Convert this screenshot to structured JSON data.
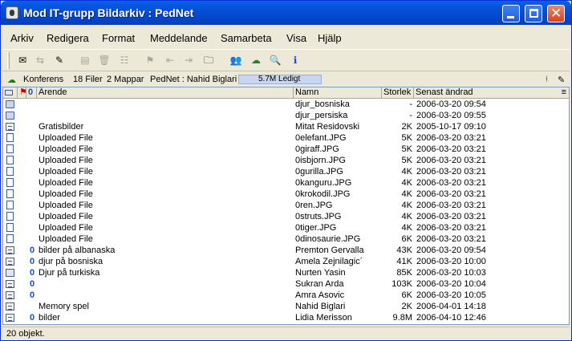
{
  "window": {
    "title": "Mod IT-grupp Bildarkiv : PedNet"
  },
  "menu": [
    "Arkiv",
    "Redigera",
    "Format",
    "Meddelande",
    "Samarbeta",
    "Visa",
    "Hjälp"
  ],
  "infobar": {
    "conference": "Konferens",
    "files": "18 Filer",
    "folders": "2 Mappar",
    "user": "PedNet : Nahid Biglari",
    "free": "5.7M Ledigt"
  },
  "columns": {
    "subject": "Ärende",
    "name": "Namn",
    "size": "Storlek",
    "date": "Senast ändrad"
  },
  "rows": [
    {
      "icon": "folder",
      "clip": "",
      "subject": "",
      "name": "djur_bosniska",
      "size": "-",
      "date": "2006-03-20  09:54"
    },
    {
      "icon": "folder",
      "clip": "",
      "subject": "",
      "name": "djur_persiska",
      "size": "-",
      "date": "2006-03-20  09:55"
    },
    {
      "icon": "msg",
      "clip": "",
      "subject": "Gratisbilder",
      "name": "Mitat Residovski",
      "size": "2K",
      "date": "2005-10-17  09:10"
    },
    {
      "icon": "file",
      "clip": "",
      "subject": "Uploaded File",
      "name": "0elefant.JPG",
      "size": "5K",
      "date": "2006-03-20  03:21"
    },
    {
      "icon": "file",
      "clip": "",
      "subject": "Uploaded File",
      "name": "0giraff.JPG",
      "size": "5K",
      "date": "2006-03-20  03:21"
    },
    {
      "icon": "file",
      "clip": "",
      "subject": "Uploaded File",
      "name": "0isbjorn.JPG",
      "size": "5K",
      "date": "2006-03-20  03:21"
    },
    {
      "icon": "file",
      "clip": "",
      "subject": "Uploaded File",
      "name": "0gurilla.JPG",
      "size": "4K",
      "date": "2006-03-20  03:21"
    },
    {
      "icon": "file",
      "clip": "",
      "subject": "Uploaded File",
      "name": "0kanguru.JPG",
      "size": "4K",
      "date": "2006-03-20  03:21"
    },
    {
      "icon": "file",
      "clip": "",
      "subject": "Uploaded File",
      "name": "0krokodil.JPG",
      "size": "4K",
      "date": "2006-03-20  03:21"
    },
    {
      "icon": "file",
      "clip": "",
      "subject": "Uploaded File",
      "name": "0ren.JPG",
      "size": "4K",
      "date": "2006-03-20  03:21"
    },
    {
      "icon": "file",
      "clip": "",
      "subject": "Uploaded File",
      "name": "0struts.JPG",
      "size": "4K",
      "date": "2006-03-20  03:21"
    },
    {
      "icon": "file",
      "clip": "",
      "subject": "Uploaded File",
      "name": "0tiger.JPG",
      "size": "4K",
      "date": "2006-03-20  03:21"
    },
    {
      "icon": "file",
      "clip": "",
      "subject": "Uploaded File",
      "name": "0dinosaurie.JPG",
      "size": "6K",
      "date": "2006-03-20  03:21"
    },
    {
      "icon": "msg",
      "clip": "0",
      "subject": "bilder på albanaska",
      "name": "Premton Gervalla",
      "size": "43K",
      "date": "2006-03-20  09:54"
    },
    {
      "icon": "msg",
      "clip": "0",
      "subject": "djur på bosniska",
      "name": "Amela Zejnilagic´",
      "size": "41K",
      "date": "2006-03-20  10:00"
    },
    {
      "icon": "cal",
      "clip": "0",
      "subject": "Djur på turkiska",
      "name": "Nurten Yasin",
      "size": "85K",
      "date": "2006-03-20  10:03"
    },
    {
      "icon": "msg",
      "clip": "0",
      "subject": "",
      "name": "Sukran Arda",
      "size": "103K",
      "date": "2006-03-20  10:04"
    },
    {
      "icon": "msg",
      "clip": "0",
      "subject": "",
      "name": "Amra Asovic",
      "size": "6K",
      "date": "2006-03-20  10:05"
    },
    {
      "icon": "msg",
      "clip": "",
      "subject": "Memory spel",
      "name": "Nahid Biglari",
      "size": "2K",
      "date": "2006-04-01  14:18"
    },
    {
      "icon": "msg",
      "clip": "0",
      "subject": "bilder",
      "name": "Lidia Merisson",
      "size": "9.8M",
      "date": "2006-04-10  12:46"
    }
  ],
  "status": "20 objekt."
}
